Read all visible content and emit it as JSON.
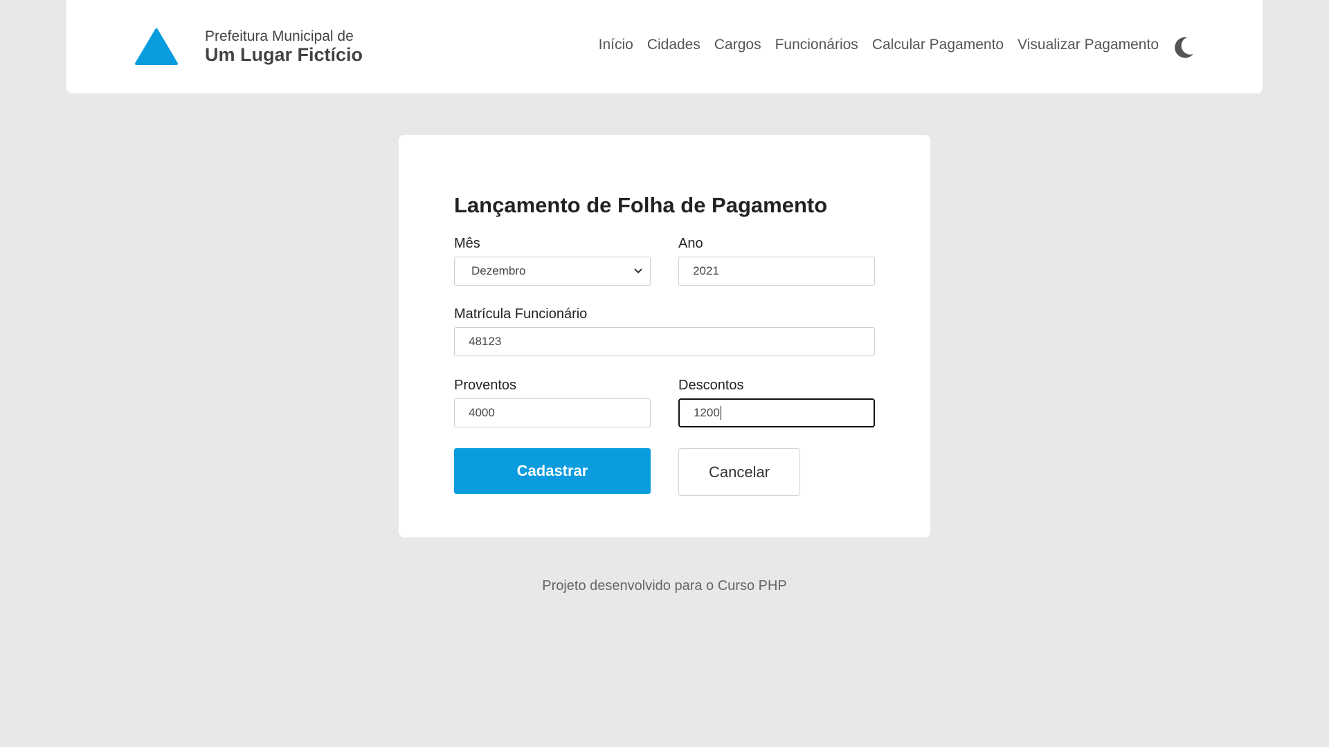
{
  "header": {
    "brand_top": "Prefeitura Municipal de",
    "brand_main": "Um Lugar Fictício",
    "logo_color": "#0a9cde",
    "nav": [
      {
        "label": "Início"
      },
      {
        "label": "Cidades"
      },
      {
        "label": "Cargos"
      },
      {
        "label": "Funcionários"
      },
      {
        "label": "Calcular Pagamento"
      },
      {
        "label": "Visualizar Pagamento"
      }
    ],
    "theme_toggle_icon": "moon-icon"
  },
  "form": {
    "title": "Lançamento de Folha de Pagamento",
    "mes": {
      "label": "Mês",
      "selected": "Dezembro"
    },
    "ano": {
      "label": "Ano",
      "value": "2021"
    },
    "matricula": {
      "label": "Matrícula Funcionário",
      "value": "48123"
    },
    "proventos": {
      "label": "Proventos",
      "value": "4000"
    },
    "descontos": {
      "label": "Descontos",
      "value": "1200"
    },
    "submit_label": "Cadastrar",
    "cancel_label": "Cancelar",
    "accent_color": "#0a9cde"
  },
  "footer": {
    "text": "Projeto desenvolvido para o Curso PHP"
  }
}
